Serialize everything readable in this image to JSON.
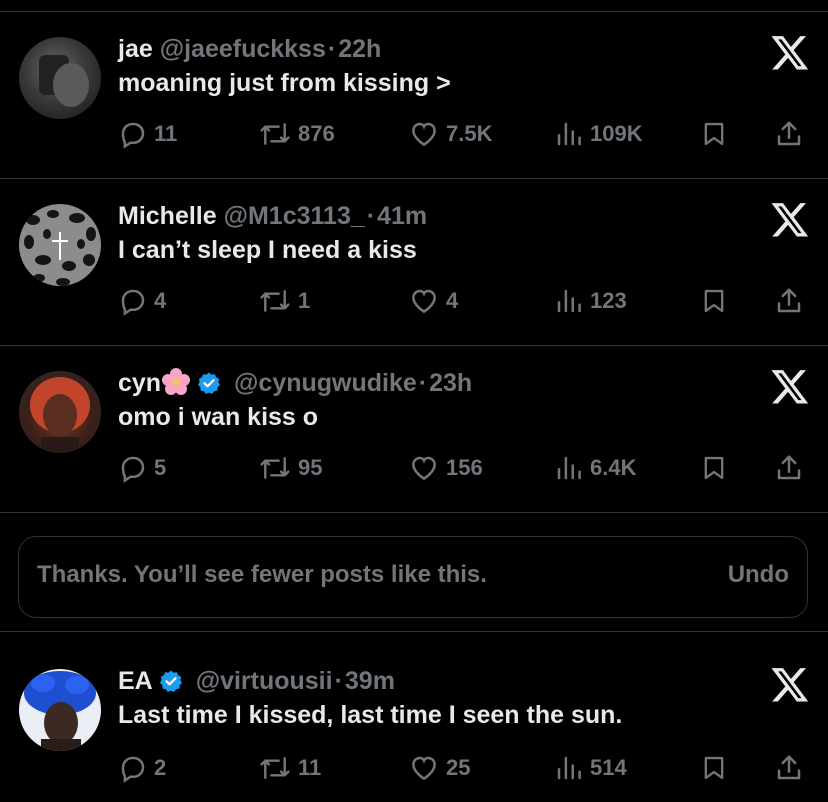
{
  "posts": [
    {
      "name": "jae",
      "handle": "@jaeefuckkss",
      "time": "22h",
      "text": "moaning just from kissing >",
      "verified": false,
      "replies": "11",
      "reposts": "876",
      "likes": "7.5K",
      "views": "109K"
    },
    {
      "name": "Michelle",
      "handle": "@M1c3113_",
      "time": "41m",
      "text": "I can’t sleep I need a kiss",
      "verified": false,
      "replies": "4",
      "reposts": "1",
      "likes": "4",
      "views": "123"
    },
    {
      "name": "cyn",
      "handle": "@cynugwudike",
      "time": "23h",
      "text": "omo i wan kiss o",
      "verified": true,
      "name_emoji": "cherry-blossom-icon",
      "replies": "5",
      "reposts": "95",
      "likes": "156",
      "views": "6.4K"
    },
    {
      "name": "EA",
      "handle": "@virtuousii",
      "time": "39m",
      "text": "Last time I kissed, last time I seen the sun.",
      "verified": true,
      "replies": "2",
      "reposts": "11",
      "likes": "25",
      "views": "514"
    }
  ],
  "separator": "·",
  "toast": {
    "message": "Thanks. You’ll see fewer posts like this.",
    "undo_label": "Undo"
  },
  "colors": {
    "background": "#000000",
    "text_primary": "#e7e9ea",
    "text_secondary": "#71767b",
    "divider": "#2f3336",
    "verified_badge": "#1d9bf0"
  }
}
